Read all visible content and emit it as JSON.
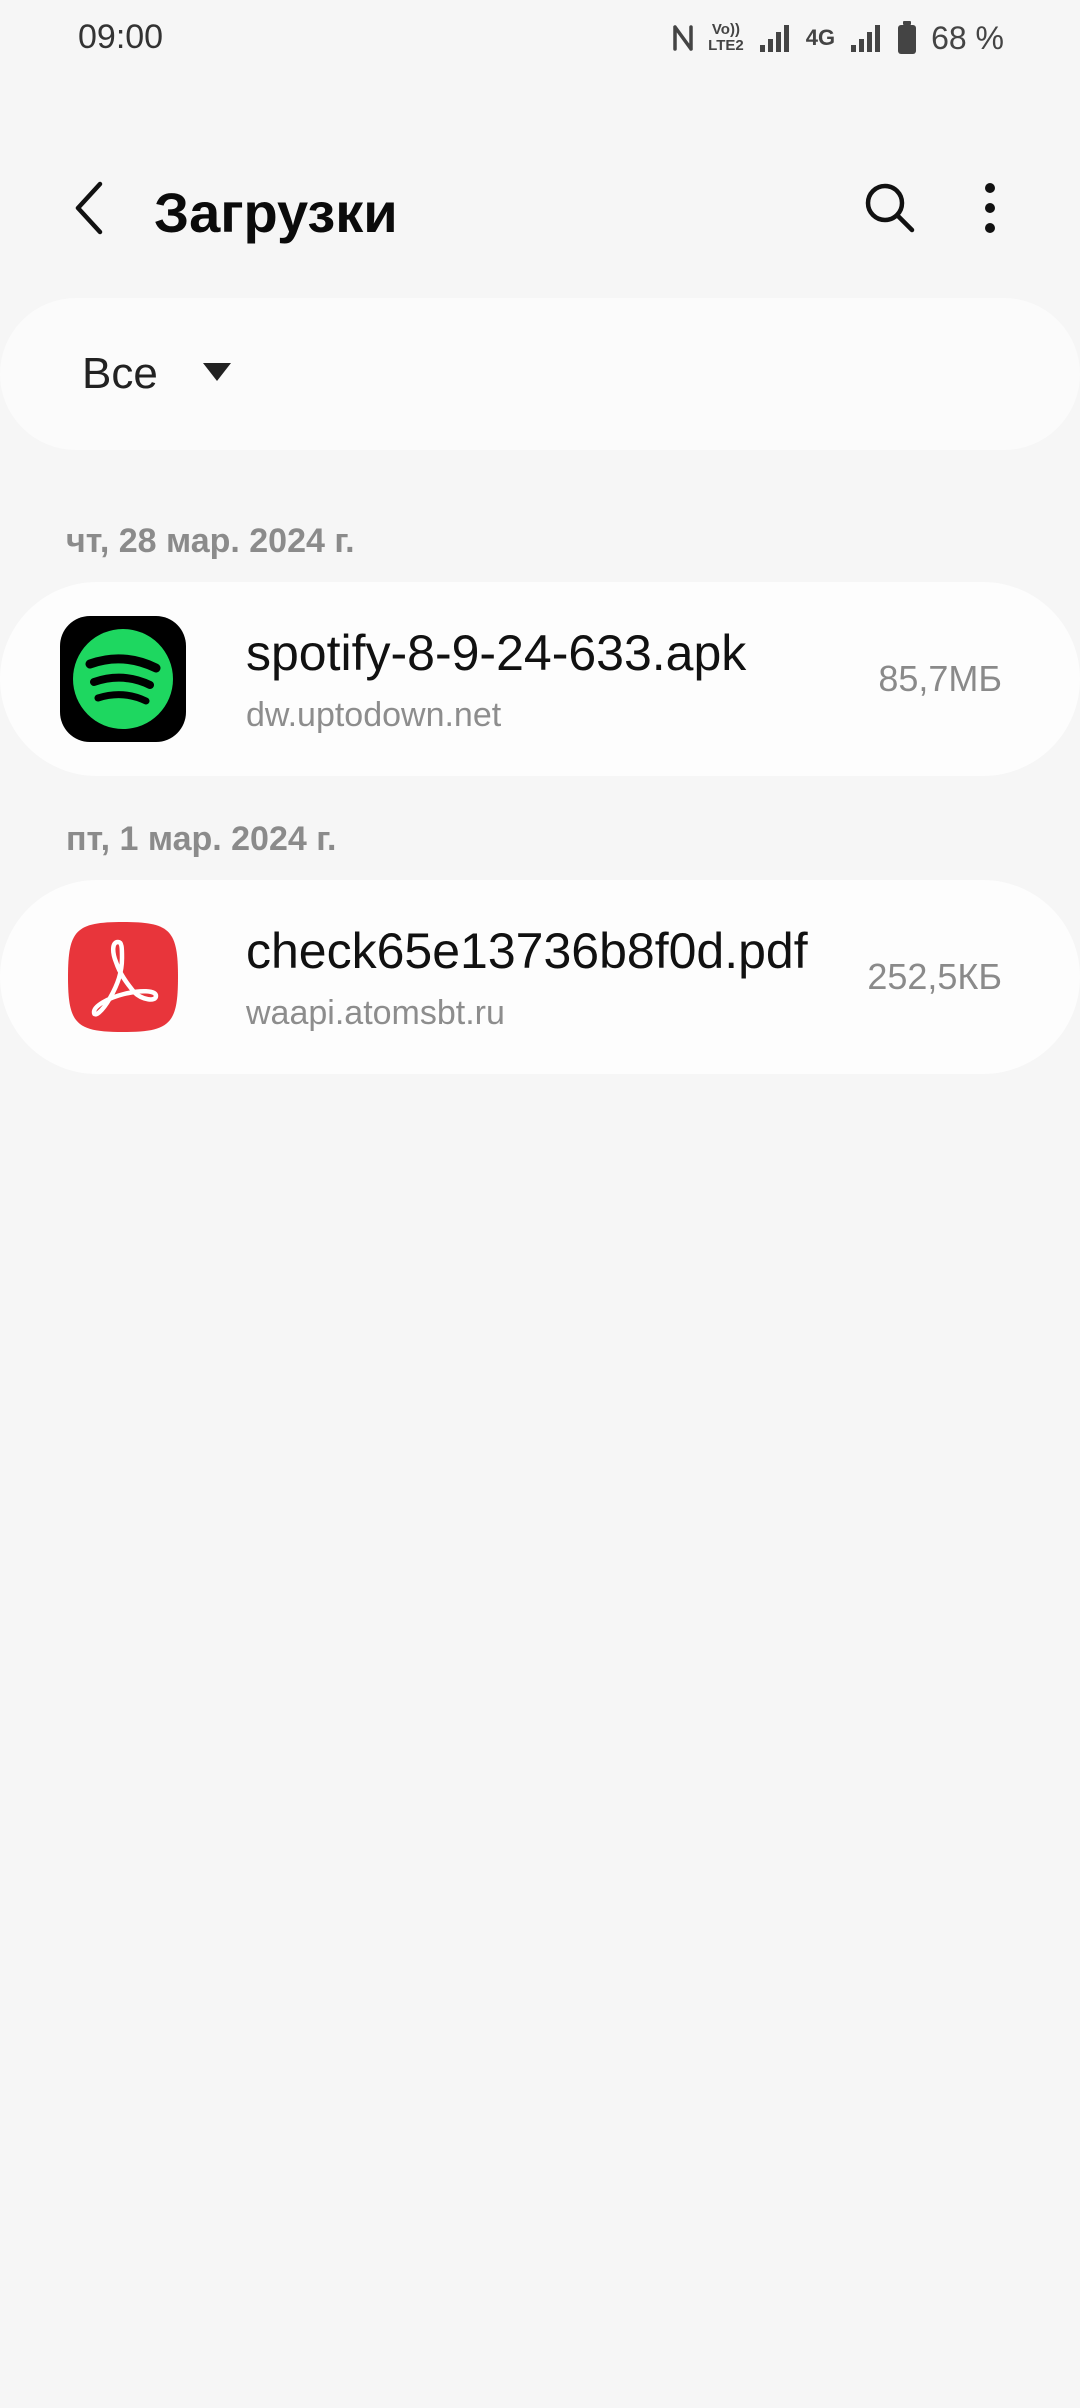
{
  "status_bar": {
    "time": "09:00",
    "volte_line1": "Vo))",
    "volte_line2": "LTE2",
    "network": "4G",
    "battery": "68 %"
  },
  "header": {
    "title": "Загрузки",
    "back_icon": "chevron-left-icon",
    "search_icon": "search-icon",
    "more_icon": "more-vert-icon"
  },
  "filter": {
    "selected": "Все",
    "icon": "dropdown-triangle-icon"
  },
  "groups": [
    {
      "date": "чт, 28 мар. 2024 г.",
      "files": [
        {
          "name": "spotify-8-9-24-633.apk",
          "source": "dw.uptodown.net",
          "size": "85,7МБ",
          "icon": "spotify-icon",
          "icon_color": "#1ed760"
        }
      ]
    },
    {
      "date": "пт, 1 мар. 2024 г.",
      "files": [
        {
          "name": "check65e13736b8f0d.pdf",
          "source": "waapi.atomsbt.ru",
          "size": "252,5КБ",
          "icon": "pdf-icon",
          "icon_color": "#e8353b"
        }
      ]
    }
  ]
}
